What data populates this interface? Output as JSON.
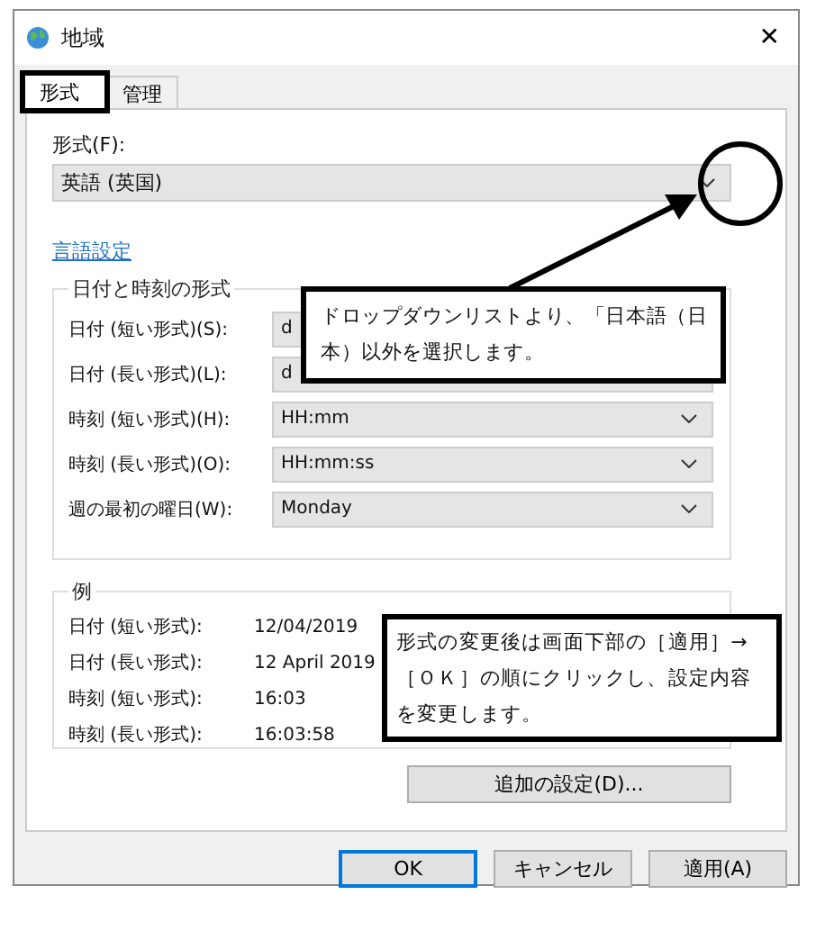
{
  "window": {
    "title": "地域",
    "close": "✕"
  },
  "tabs": [
    {
      "label": "形式",
      "selected": true
    },
    {
      "label": "管理",
      "selected": false
    }
  ],
  "format": {
    "label": "形式(F):",
    "value": "英語 (英国)"
  },
  "language_link": "言語設定",
  "date_time_formats": {
    "title": "日付と時刻の形式",
    "rows": [
      {
        "label": "日付 (短い形式)(S):",
        "value": "d"
      },
      {
        "label": "日付 (長い形式)(L):",
        "value": "d"
      },
      {
        "label": "時刻 (短い形式)(H):",
        "value": "HH:mm"
      },
      {
        "label": "時刻 (長い形式)(O):",
        "value": "HH:mm:ss"
      },
      {
        "label": "週の最初の曜日(W):",
        "value": "Monday"
      }
    ]
  },
  "examples": {
    "title": "例",
    "rows": [
      {
        "label": "日付 (短い形式):",
        "value": "12/04/2019"
      },
      {
        "label": "日付 (長い形式):",
        "value": "12 April 2019"
      },
      {
        "label": "時刻 (短い形式):",
        "value": "16:03"
      },
      {
        "label": "時刻 (長い形式):",
        "value": "16:03:58"
      }
    ]
  },
  "additional_button": "追加の設定(D)...",
  "buttons": [
    {
      "label": "OK",
      "default": true
    },
    {
      "label": "キャンセル",
      "default": false
    },
    {
      "label": "適用(A)",
      "default": false
    }
  ],
  "annotations": [
    {
      "text": "ドロップダウンリストより、「日本語（日本）以外を選択します。"
    },
    {
      "text": "形式の変更後は画面下部の［適用］→［ＯＫ］の順にクリックし、設定内容を変更します。"
    }
  ]
}
